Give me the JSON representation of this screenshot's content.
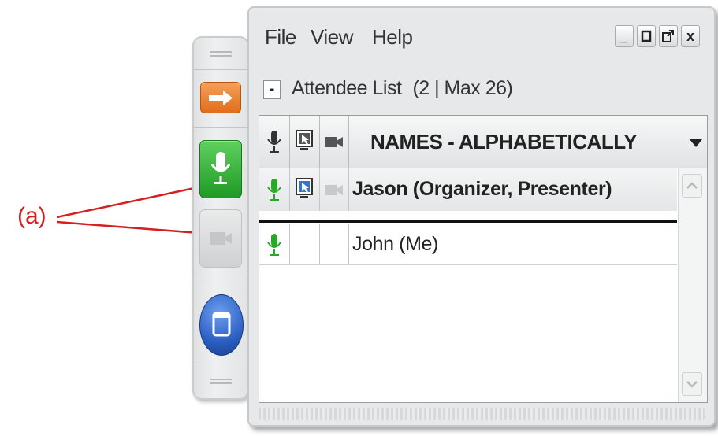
{
  "annotation": {
    "label": "(a)"
  },
  "menu": {
    "file": "File",
    "view": "View",
    "help": "Help"
  },
  "window_controls": {
    "minimize": "_",
    "close": "x"
  },
  "attendee": {
    "collapse": "-",
    "title": "Attendee List",
    "count": "(2 | Max 26)"
  },
  "list": {
    "sort_header": "NAMES - ALPHABETICALLY",
    "rows": [
      {
        "name": "Jason (Organizer, Presenter)",
        "mic": "on",
        "screen_share": true,
        "camera": "off"
      },
      {
        "name": "John (Me)",
        "mic": "on",
        "screen_share": false,
        "camera": "none"
      }
    ]
  },
  "colors": {
    "mic_green": "#2aa62a",
    "annotation_red": "#d42020",
    "orange_button": "#e26d1b",
    "blue_button": "#2a5fc4"
  },
  "icons": [
    "grip-icon",
    "exit-arrow-icon",
    "microphone-icon",
    "camera-icon",
    "window-icon",
    "screen-share-icon",
    "chevron-up-icon",
    "chevron-down-icon"
  ]
}
